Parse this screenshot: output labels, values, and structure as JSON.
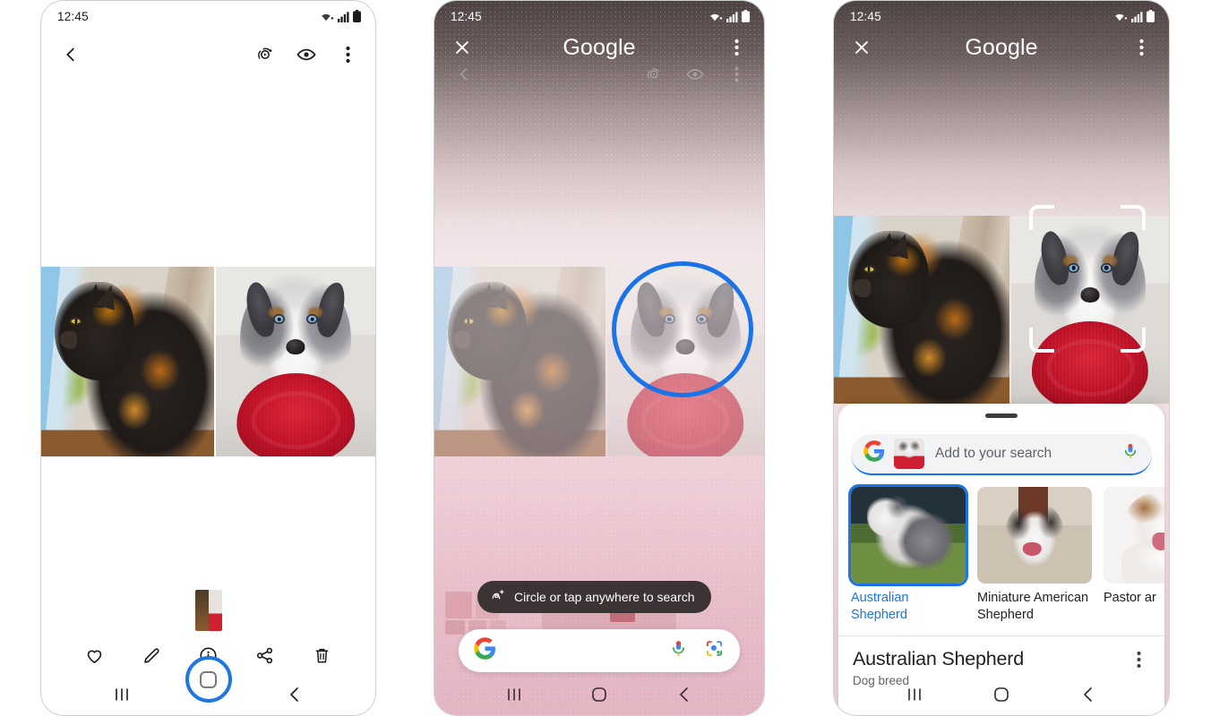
{
  "meta": {
    "scene": "Samsung Galaxy Circle to Search flow, three screens"
  },
  "status_bar": {
    "time": "12:45",
    "icons": [
      "wifi-icon",
      "cellular-signal-icon",
      "battery-icon"
    ]
  },
  "phone1": {
    "app": "Gallery",
    "header": {
      "back_icon": "chevron-left-icon",
      "actions": [
        "motion-photo-icon",
        "eye-view-icon",
        "more-vertical-icon"
      ]
    },
    "photos": [
      {
        "name": "tortoiseshell cat at window",
        "alt": "Cat looking out a window"
      },
      {
        "name": "australian shepherd with red frisbee",
        "alt": "Dog holding a red frisbee"
      }
    ],
    "toolbar": [
      {
        "icon": "heart-icon",
        "label": "Favorite"
      },
      {
        "icon": "pencil-icon",
        "label": "Edit"
      },
      {
        "icon": "info-icon",
        "label": "Info"
      },
      {
        "icon": "share-icon",
        "label": "Share"
      },
      {
        "icon": "trash-icon",
        "label": "Delete"
      }
    ],
    "nav": [
      "recents-icon",
      "home-icon",
      "back-icon"
    ],
    "home_highlighted": true
  },
  "phone2": {
    "header": {
      "close_icon": "close-icon",
      "title": "Google",
      "more_icon": "more-vertical-icon"
    },
    "ghost_header": {
      "back_icon": "chevron-left-icon",
      "actions": [
        "motion-photo-icon",
        "eye-view-icon",
        "more-vertical-icon"
      ]
    },
    "tooltip": {
      "icon": "circle-gesture-icon",
      "text": "Circle or tap anywhere to search"
    },
    "search_pill": {
      "value": "",
      "placeholder": "",
      "leading_icon": "google-g-icon",
      "trailing_icons": [
        "microphone-icon",
        "google-lens-icon"
      ]
    },
    "selection": {
      "shape": "circle",
      "color": "#1a73e8",
      "target": "dog face"
    },
    "nav": [
      "recents-icon",
      "home-icon",
      "back-icon"
    ]
  },
  "phone3": {
    "header": {
      "close_icon": "close-icon",
      "title": "Google",
      "more_icon": "more-vertical-icon"
    },
    "selection": {
      "shape": "corner-brackets",
      "color": "#ffffff",
      "target": "dog"
    },
    "sheet": {
      "handle": "drag-handle",
      "search": {
        "leading_icon": "google-g-icon",
        "thumbnail": "selected-dog-thumbnail",
        "placeholder": "Add to your search",
        "trailing_icon": "microphone-icon",
        "value": ""
      },
      "results": [
        {
          "label": "Australian Shepherd",
          "selected": true
        },
        {
          "label": "Miniature American Shepherd",
          "selected": false
        },
        {
          "label": "Pastor ar",
          "selected": false
        }
      ],
      "detail": {
        "title": "Australian Shepherd",
        "subtitle": "Dog breed",
        "more_icon": "more-vertical-icon"
      }
    },
    "nav": [
      "recents-icon",
      "home-icon",
      "back-icon"
    ]
  },
  "colors": {
    "accent_blue": "#1a73e8",
    "home_ring_blue": "#1f77e0",
    "tooltip_bg": "#3c3434",
    "sheet_bg": "#ffffff",
    "text_primary": "#202124",
    "text_secondary": "#5f6368"
  }
}
